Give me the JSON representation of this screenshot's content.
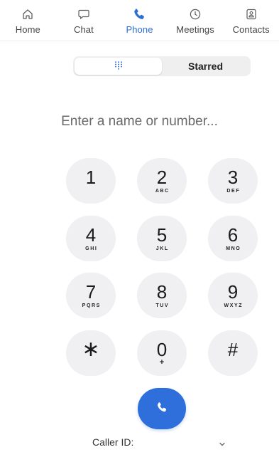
{
  "tabs": [
    {
      "id": "home",
      "label": "Home",
      "icon": "home-icon"
    },
    {
      "id": "chat",
      "label": "Chat",
      "icon": "chat-bubble-icon"
    },
    {
      "id": "phone",
      "label": "Phone",
      "icon": "phone-icon",
      "active": true
    },
    {
      "id": "meetings",
      "label": "Meetings",
      "icon": "clock-icon"
    },
    {
      "id": "contacts",
      "label": "Contacts",
      "icon": "contact-card-icon"
    }
  ],
  "segmented": {
    "keypad_icon": "keypad-grid-icon",
    "starred_label": "Starred",
    "selected": "keypad"
  },
  "dialer": {
    "placeholder": "Enter a name or number...",
    "value": ""
  },
  "keypad": [
    {
      "digit": "1",
      "letters": ""
    },
    {
      "digit": "2",
      "letters": "ABC"
    },
    {
      "digit": "3",
      "letters": "DEF"
    },
    {
      "digit": "4",
      "letters": "GHI"
    },
    {
      "digit": "5",
      "letters": "JKL"
    },
    {
      "digit": "6",
      "letters": "MNO"
    },
    {
      "digit": "7",
      "letters": "PQRS"
    },
    {
      "digit": "8",
      "letters": "TUV"
    },
    {
      "digit": "9",
      "letters": "WXYZ"
    },
    {
      "digit": "∗",
      "letters": ""
    },
    {
      "digit": "0",
      "letters": "+"
    },
    {
      "digit": "#",
      "letters": ""
    }
  ],
  "call_button": {
    "icon": "phone-handset-icon"
  },
  "caller_id": {
    "label": "Caller ID:",
    "icon": "chevron-down-icon"
  },
  "colors": {
    "accent": "#2f6fdc",
    "key_bg": "#f0f0f2",
    "active_tab": "#2c6ed6"
  }
}
